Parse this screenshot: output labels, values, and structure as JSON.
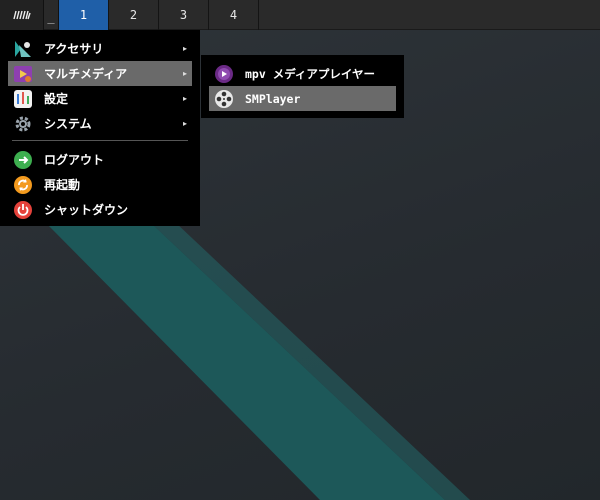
{
  "panel": {
    "launcher_icon": "launcher-logo-icon",
    "minimize_label": "_",
    "workspaces": [
      {
        "label": "1",
        "active": true
      },
      {
        "label": "2",
        "active": false
      },
      {
        "label": "3",
        "active": false
      },
      {
        "label": "4",
        "active": false
      }
    ],
    "active_color": "#1f5fa8"
  },
  "main_menu": {
    "items": [
      {
        "label": "アクセサリ",
        "icon": "accessories-icon",
        "submenu": true
      },
      {
        "label": "マルチメディア",
        "icon": "multimedia-icon",
        "submenu": true,
        "highlighted": true
      },
      {
        "label": "設定",
        "icon": "settings-icon",
        "submenu": true
      },
      {
        "label": "システム",
        "icon": "system-gear-icon",
        "submenu": true
      },
      {
        "label": "ログアウト",
        "icon": "logout-icon",
        "submenu": false
      },
      {
        "label": "再起動",
        "icon": "restart-icon",
        "submenu": false
      },
      {
        "label": "シャットダウン",
        "icon": "shutdown-icon",
        "submenu": false
      }
    ],
    "arrow": "▸"
  },
  "sub_menu": {
    "items": [
      {
        "label": "mpv メディアプレイヤー",
        "icon": "mpv-icon"
      },
      {
        "label": "SMPlayer",
        "icon": "smplayer-reel-icon",
        "highlighted": true
      }
    ]
  },
  "colors": {
    "menu_bg": "#000000",
    "highlight": "#6a6a6a",
    "desktop_stripe": "#1f5a5a"
  }
}
